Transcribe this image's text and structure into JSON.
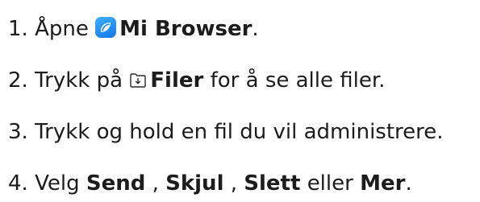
{
  "steps": [
    {
      "number": "1.",
      "prefix": "Åpne",
      "app_name": "Mi Browser",
      "suffix": "."
    },
    {
      "number": "2.",
      "prefix": "Trykk på",
      "button_name": "Filer",
      "suffix": "for å se alle filer."
    },
    {
      "number": "3.",
      "text": "Trykk og hold en fil du vil administrere."
    },
    {
      "number": "4.",
      "prefix": "Velg",
      "option_1": "Send",
      "sep_1": ",",
      "option_2": "Skjul",
      "sep_2": ",",
      "option_3": "Slett",
      "connector": "eller",
      "option_4": "Mer",
      "suffix": "."
    }
  ],
  "icons": {
    "browser": "mi-browser-icon",
    "files": "files-folder-icon"
  },
  "colors": {
    "text": "#1c1c1c",
    "browser_icon": "#1a86f0"
  }
}
